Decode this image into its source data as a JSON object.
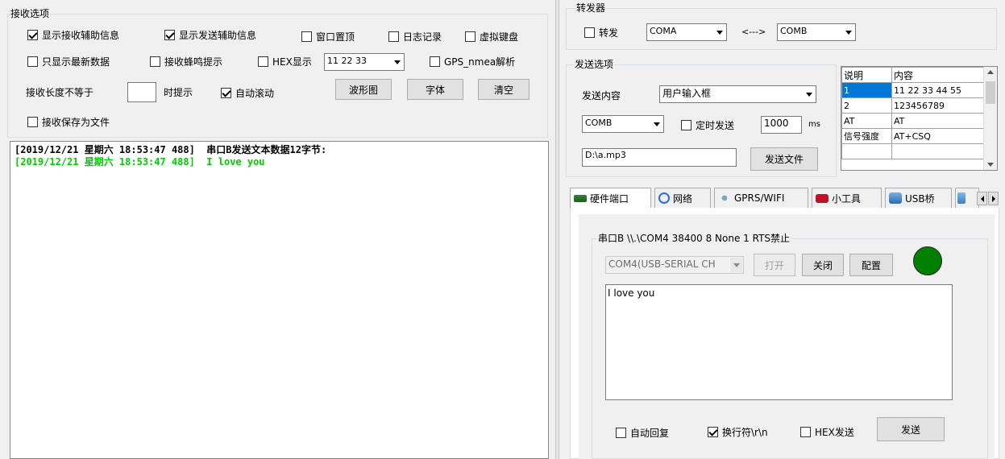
{
  "receive": {
    "title": "接收选项",
    "show_rx_info": "显示接收辅助信息",
    "show_tx_info": "显示发送辅助信息",
    "topmost": "窗口置顶",
    "log": "日志记录",
    "virtual_kbd": "虚拟键盘",
    "latest_only": "只显示最新数据",
    "beep": "接收蜂鸣提示",
    "hex_show": "HEX显示",
    "hex_sample": "11 22 33",
    "gps": "GPS_nmea解析",
    "len_prefix": "接收长度不等于",
    "len_suffix": "时提示",
    "autoscroll": "自动滚动",
    "waveform": "波形图",
    "font": "字体",
    "clear": "清空",
    "save_file": "接收保存为文件"
  },
  "log_lines": [
    {
      "text": "[2019/12/21 星期六 18:53:47 488]  串口B发送文本数据12字节:",
      "color": "#000000"
    },
    {
      "text": "[2019/12/21 星期六 18:53:47 488]  I love you",
      "color": "#00cc00"
    }
  ],
  "forward": {
    "title": "转发器",
    "enable": "转发",
    "port_a": "COMA",
    "arrow": "<--->",
    "port_b": "COMB"
  },
  "send": {
    "title": "发送选项",
    "content_label": "发送内容",
    "content_value": "用户输入框",
    "port": "COMB",
    "timed": "定时发送",
    "interval": "1000",
    "unit": "ms",
    "file_path": "D:\\a.mp3",
    "send_file": "发送文件"
  },
  "table": {
    "headers": [
      "说明",
      "内容"
    ],
    "rows": [
      [
        "1",
        "11 22 33 44 55"
      ],
      [
        "2",
        "123456789"
      ],
      [
        "AT",
        "AT"
      ],
      [
        "信号强度",
        "AT+CSQ"
      ]
    ]
  },
  "tabs": [
    "硬件端口",
    "网络",
    "GPRS/WIFI",
    "小工具",
    "USB桥"
  ],
  "serial": {
    "title": "串口B \\\\.\\COM4  38400  8  None  1  RTS禁止",
    "port_select": "COM4(USB-SERIAL CH",
    "open": "打开",
    "close": "关闭",
    "config": "配置",
    "status_color": "#008000",
    "input_text": "I love you",
    "auto_reply": "自动回复",
    "newline": "换行符\\r\\n",
    "hex_send": "HEX发送",
    "send": "发送"
  }
}
